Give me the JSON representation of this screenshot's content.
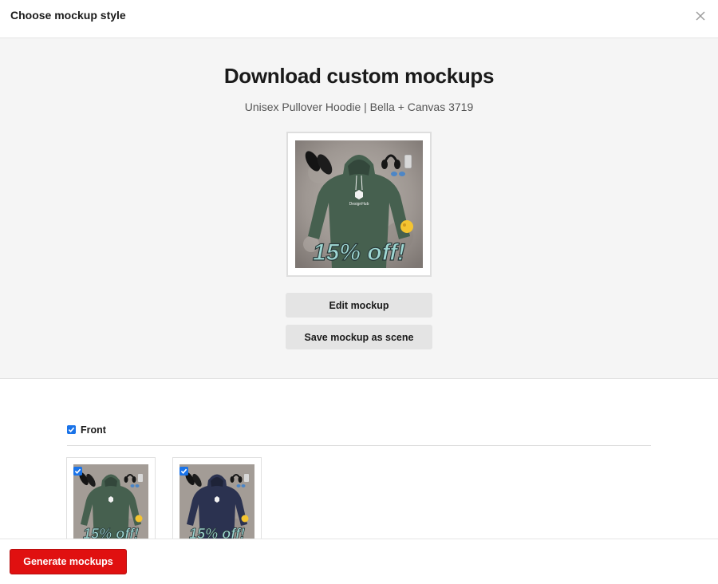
{
  "header": {
    "title": "Choose mockup style",
    "close_icon": "close-icon"
  },
  "hero": {
    "title": "Download custom mockups",
    "subtitle": "Unisex Pullover Hoodie | Bella + Canvas 3719",
    "preview": {
      "hoodie_color": "#46604f",
      "logo_text": "DesignHub",
      "promo_text": "15% off!"
    },
    "edit_button": "Edit mockup",
    "save_button": "Save mockup as scene"
  },
  "placement": {
    "label": "Front",
    "checked": true,
    "thumbnails": [
      {
        "color_name": "green",
        "hoodie_color": "#46604f",
        "promo_text": "15% off!",
        "selected": true
      },
      {
        "color_name": "navy",
        "hoodie_color": "#2b3250",
        "promo_text": "15% off!",
        "selected": true
      }
    ]
  },
  "footer": {
    "generate_button": "Generate mockups",
    "accent_color": "#e01010"
  }
}
